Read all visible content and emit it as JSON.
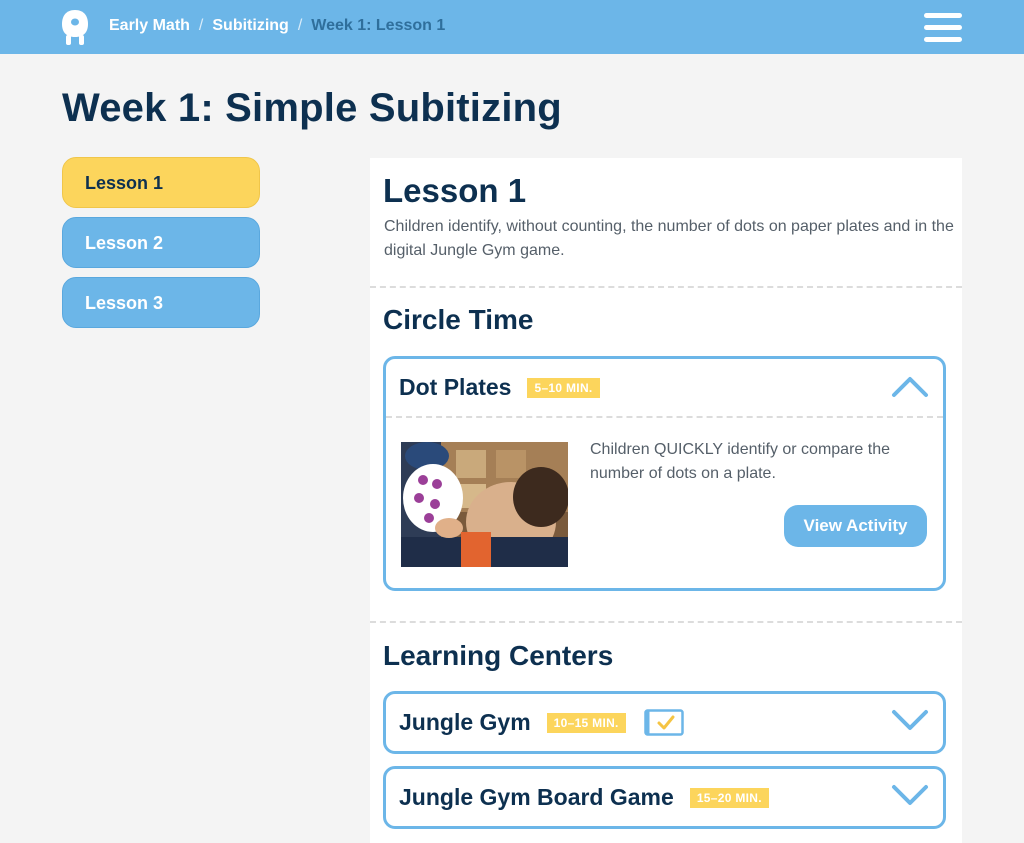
{
  "header": {
    "logo_icon": "owl-mascot-logo-icon",
    "breadcrumb": {
      "items": [
        "Early Math",
        "Subitizing"
      ],
      "separator": "/",
      "current": "Week 1: Lesson 1"
    },
    "menu_icon": "hamburger-menu-icon"
  },
  "page": {
    "title": "Week 1: Simple Subitizing"
  },
  "sidebar": {
    "lessons": [
      {
        "label": "Lesson 1",
        "active": true
      },
      {
        "label": "Lesson 2",
        "active": false
      },
      {
        "label": "Lesson 3",
        "active": false
      }
    ]
  },
  "lesson": {
    "heading": "Lesson 1",
    "description": "Children identify, without counting, the number of dots on paper plates and in the digital Jungle Gym game."
  },
  "circle_time": {
    "heading": "Circle Time",
    "activity": {
      "title": "Dot Plates",
      "duration": "5–10 MIN.",
      "expanded": true,
      "chevron_icon": "chevron-up-icon",
      "description": "Children QUICKLY identify or compare the number of dots on a plate.",
      "button_label": "View Activity"
    }
  },
  "learning_centers": {
    "heading": "Learning Centers",
    "activities": [
      {
        "title": "Jungle Gym",
        "duration": "10–15 MIN.",
        "has_digital": true,
        "chevron_icon": "chevron-down-icon"
      },
      {
        "title": "Jungle Gym Board Game",
        "duration": "15–20 MIN.",
        "has_digital": false,
        "chevron_icon": "chevron-down-icon"
      }
    ]
  },
  "colors": {
    "accent_blue": "#6cb6e8",
    "accent_yellow": "#fcd55c",
    "navy": "#0d3050"
  }
}
